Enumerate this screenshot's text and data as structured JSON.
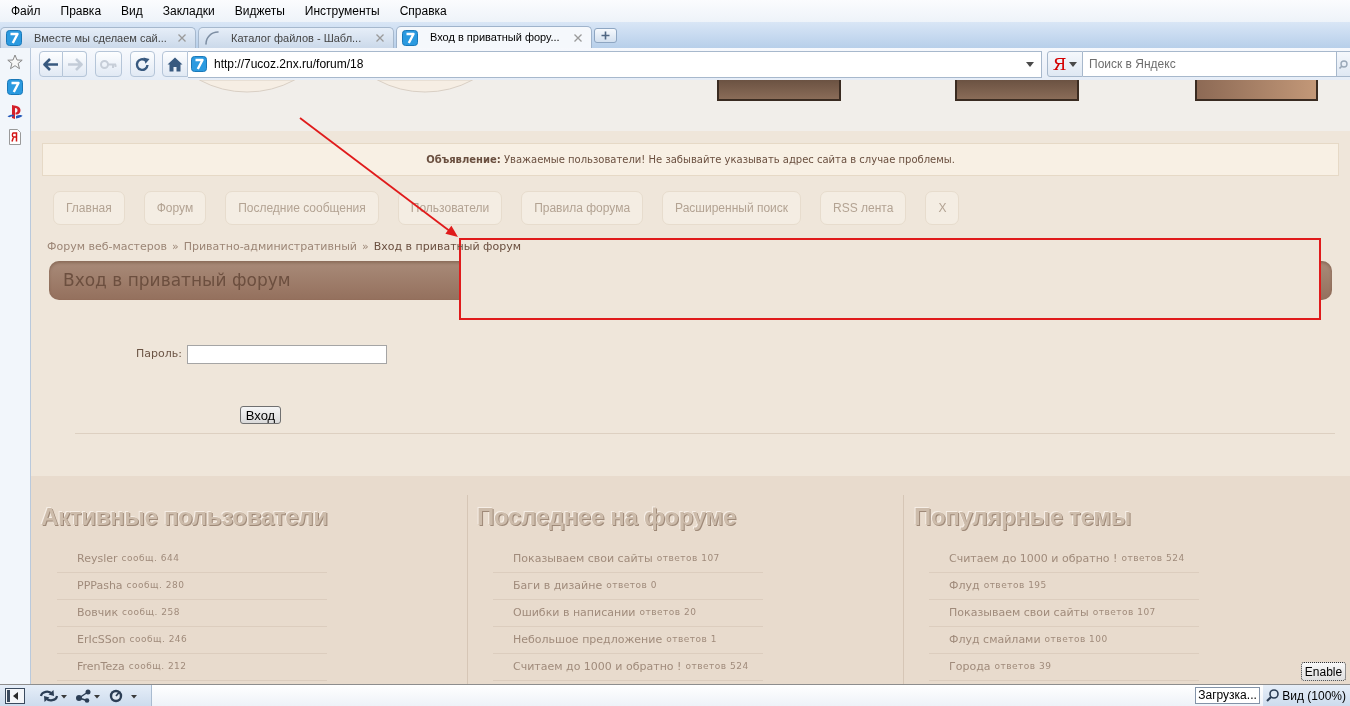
{
  "menu_bar": {
    "items": [
      "Файл",
      "Правка",
      "Вид",
      "Закладки",
      "Виджеты",
      "Инструменты",
      "Справка"
    ]
  },
  "tabs": [
    {
      "title": "Вместе мы сделаем сай...",
      "kind": "site",
      "selected": false
    },
    {
      "title": "Каталог файлов - Шабл...",
      "kind": "loading",
      "selected": false
    },
    {
      "title": "Вход в приватный фору...",
      "kind": "site",
      "selected": true
    }
  ],
  "address_bar": {
    "url": "http://7ucoz.2nx.ru/forum/18"
  },
  "search": {
    "engine": "Я",
    "placeholder": "Поиск в Яндекс"
  },
  "page": {
    "announcement": "**Объявление:** Уважаемые пользователи! Не забывайте указывать адрес сайта в случае проблемы.",
    "nav": [
      "Главная",
      "Форум",
      "Последние сообщения",
      "Пользователи",
      "Правила форума",
      "Расширенный поиск",
      "RSS лента",
      "X"
    ],
    "breadcrumb": {
      "items": [
        {
          "label": "Форум веб-мастеров",
          "current": false
        },
        {
          "label": "Приватно-административный",
          "current": false
        },
        {
          "label": "Вход в приватный форум",
          "current": true
        }
      ],
      "separators": [
        "»",
        "»"
      ]
    },
    "heading": "Вход в приватный форум",
    "login_form": {
      "password_label": "Пароль:",
      "submit": "Вход"
    },
    "columns": [
      {
        "title": "Активные пользователи",
        "items": [
          {
            "label": "Reysler",
            "count": "сообщ. 644"
          },
          {
            "label": "PPPasha",
            "count": "сообщ. 280"
          },
          {
            "label": "Вовчик",
            "count": "сообщ. 258"
          },
          {
            "label": "ErIcSSon",
            "count": "сообщ. 246"
          },
          {
            "label": "FrenTeza",
            "count": "сообщ. 212"
          }
        ]
      },
      {
        "title": "Последнее на форуме",
        "items": [
          {
            "label": "Показываем свои сайты",
            "count": "ответов 107"
          },
          {
            "label": "Баги в дизайне",
            "count": "ответов 0"
          },
          {
            "label": "Ошибки в написании",
            "count": "ответов 20"
          },
          {
            "label": "Небольшое предложение",
            "count": "ответов 1"
          },
          {
            "label": "Считаем до 1000 и обратно !",
            "count": "ответов 524"
          }
        ]
      },
      {
        "title": "Популярные темы",
        "items": [
          {
            "label": "Считаем до 1000 и обратно !",
            "count": "ответов 524"
          },
          {
            "label": "Флуд",
            "count": "ответов 195"
          },
          {
            "label": "Показываем свои сайты",
            "count": "ответов 107"
          },
          {
            "label": "Флуд смайлами",
            "count": "ответов 100"
          },
          {
            "label": "Города",
            "count": "ответов 39"
          }
        ]
      }
    ],
    "enable_button": "Enable"
  },
  "status_bar": {
    "loading": "Загрузка...",
    "zoom": "Вид (100%)"
  }
}
